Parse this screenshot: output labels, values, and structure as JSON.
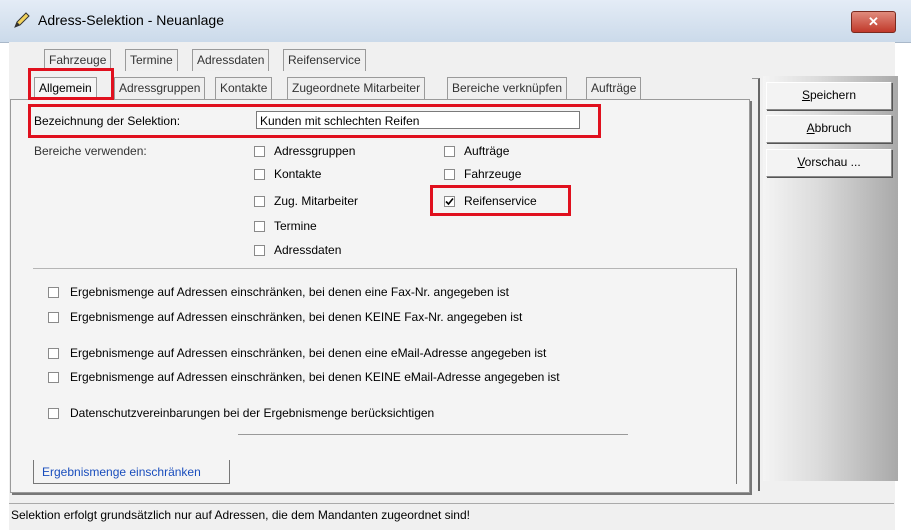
{
  "window": {
    "title": "Adress-Selektion - Neuanlage",
    "close_label": "✕"
  },
  "tabs_row1": [
    "Fahrzeuge",
    "Termine",
    "Adressdaten",
    "Reifenservice"
  ],
  "tabs_row2": [
    "Allgemein",
    "Adressgruppen",
    "Kontakte",
    "Zugeordnete Mitarbeiter",
    "Bereiche verknüpfen",
    "Aufträge"
  ],
  "buttons": {
    "save_first": "S",
    "save_rest": "peichern",
    "cancel_first": "A",
    "cancel_rest": "bbruch",
    "preview_first": "V",
    "preview_rest": "orschau ..."
  },
  "form": {
    "name_label": "Bezeichnung der Selektion:",
    "name_value": "Kunden mit schlechten Reifen",
    "areas_label": "Bereiche verwenden:"
  },
  "areas": {
    "adressgruppen": {
      "label": "Adressgruppen",
      "checked": false
    },
    "kontakte": {
      "label": "Kontakte",
      "checked": false
    },
    "zug_mitarbeiter": {
      "label": "Zug. Mitarbeiter",
      "checked": false
    },
    "termine": {
      "label": "Termine",
      "checked": false
    },
    "adressdaten": {
      "label": "Adressdaten",
      "checked": false
    },
    "auftraege": {
      "label": "Aufträge",
      "checked": false
    },
    "fahrzeuge": {
      "label": "Fahrzeuge",
      "checked": false
    },
    "reifenservice": {
      "label": "Reifenservice",
      "checked": true
    }
  },
  "restrictions": {
    "fax_yes": "Ergebnismenge auf Adressen einschränken, bei denen eine Fax-Nr. angegeben ist",
    "fax_no": "Ergebnismenge auf Adressen einschränken, bei denen KEINE Fax-Nr. angegeben ist",
    "email_yes": "Ergebnismenge auf Adressen einschränken, bei denen eine eMail-Adresse angegeben ist",
    "email_no": "Ergebnismenge auf Adressen einschränken, bei denen KEINE eMail-Adresse angegeben ist",
    "privacy": "Datenschutzvereinbarungen bei der Ergebnismenge berücksichtigen"
  },
  "bottom_tab": "Ergebnismenge einschränken",
  "status": "Selektion erfolgt grundsätzlich nur auf Adressen, die dem Mandanten zugeordnet sind!",
  "colors": {
    "highlight": "#e0101e",
    "link_blue": "#1a4ebd"
  }
}
